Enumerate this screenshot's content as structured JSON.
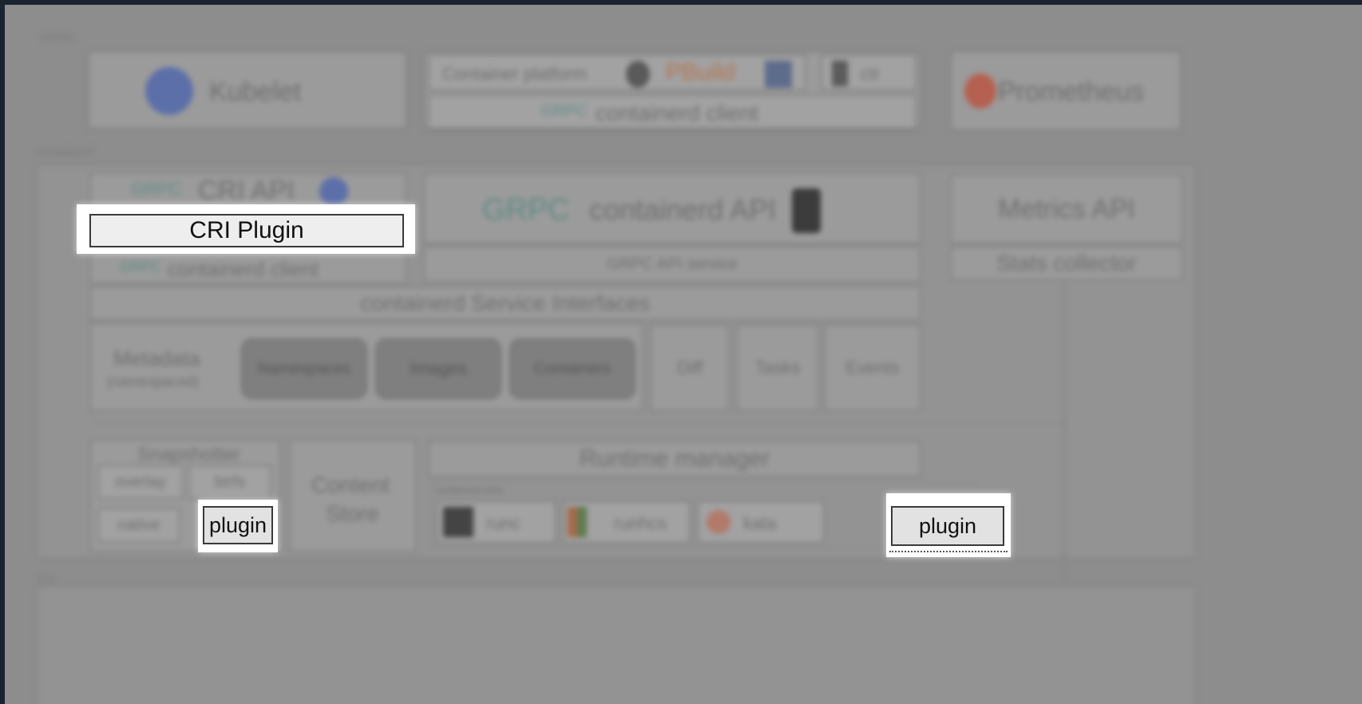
{
  "sections": {
    "clients": "clients",
    "containerd": "containerd",
    "os": "OS"
  },
  "clients": {
    "kubelet": "Kubelet",
    "container_platform": "Container platform",
    "openshift": "PBuild",
    "ctr": "ctr",
    "containerd_client": "containerd client",
    "prometheus": "Prometheus"
  },
  "containerd": {
    "cri_api": "CRI API",
    "cri_plugin": "CRI Plugin",
    "cri_containerd_client": "containerd client",
    "containerd_api": "containerd API",
    "grpc_api_service": "GRPC API service",
    "metrics_api": "Metrics API",
    "stats_collector": "Stats collector",
    "service_interfaces": "containerd Service Interfaces",
    "metadata": "Metadata",
    "metadata_sub": "(namespaced)",
    "namespaces": "Namespaces",
    "images": "Images",
    "containers": "Containers",
    "diff": "Diff",
    "tasks": "Tasks",
    "events": "Events",
    "snapshotter": "Snapshotter",
    "overlay": "overlay",
    "btrfs": "btrfs",
    "native": "native",
    "snapshot_plugin": "plugin",
    "content_store_1": "Content",
    "content_store_2": "Store",
    "runtime_manager": "Runtime manager",
    "containerd_shim": "containerd-shim",
    "runc": "runc",
    "runhcs": "runhcs",
    "kata": "kata",
    "runtime_plugin": "plugin"
  },
  "logos": {
    "grpc": "GRPC",
    "kubelet_logo": "kubernetes-logo",
    "prometheus_logo": "prometheus-logo"
  },
  "colors": {
    "background": "#8d8d8d",
    "frame": "#1b2330",
    "highlight": "#ffffff"
  }
}
